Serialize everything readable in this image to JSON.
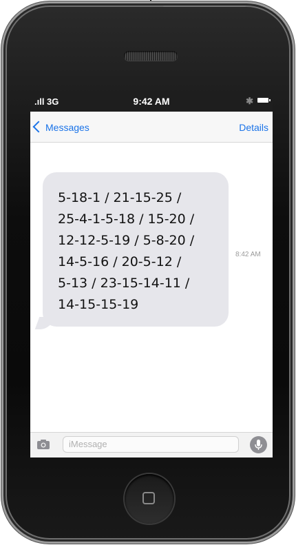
{
  "status": {
    "signal": ".ıll 3G",
    "time": "9:42 AM",
    "bluetooth": "✱"
  },
  "nav": {
    "back_label": "Messages",
    "details_label": "Details"
  },
  "message": {
    "text": "5-18-1 / 21-15-25 /\n25-4-1-5-18 / 15-20 /\n12-12-5-19 / 5-8-20 /\n14-5-16 / 20-5-12 /\n5-13 / 23-15-14-11 /\n14-15-15-19",
    "timestamp": "8:42 AM"
  },
  "input": {
    "placeholder": "iMessage"
  },
  "colors": {
    "accent": "#1a73e8",
    "bubble": "#e6e6eb",
    "statusbar": "#1e1e1e"
  }
}
